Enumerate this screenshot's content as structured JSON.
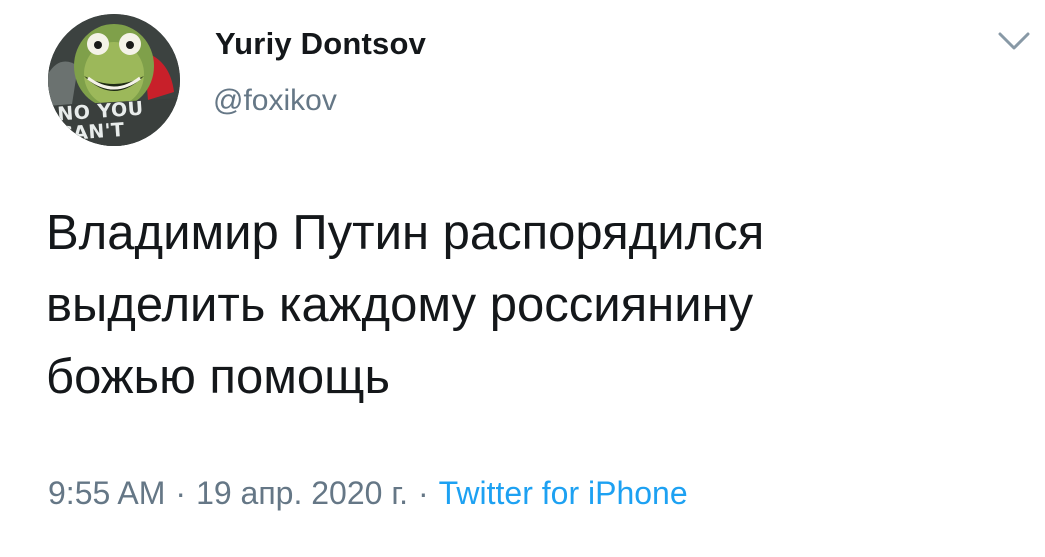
{
  "author": {
    "name": "Yuriy Dontsov",
    "handle": "@foxikov",
    "avatar_caption": "NO YOU CAN'T"
  },
  "tweet": {
    "text": "Владимир Путин распорядился\nвыделить каждому россиянину\nбожью помощь"
  },
  "meta": {
    "time": "9:55 AM",
    "separator": "·",
    "date": "19 апр. 2020 г.",
    "separator2": "·",
    "source": "Twitter for iPhone"
  },
  "icons": {
    "more": "chevron-down-icon"
  },
  "colors": {
    "text": "#14171a",
    "secondary": "#657786",
    "link": "#1da1f2"
  }
}
